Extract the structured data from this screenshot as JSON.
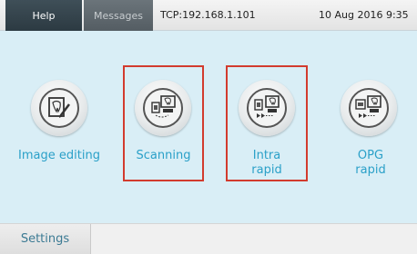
{
  "topbar": {
    "help_label": "Help",
    "messages_label": "Messages",
    "connection": "TCP:192.168.1.101",
    "datetime": "10 Aug 2016 9:35"
  },
  "modes": [
    {
      "label": "Image editing",
      "icon": "image-editing-icon",
      "highlighted": false
    },
    {
      "label": "Scanning",
      "icon": "scanning-icon",
      "highlighted": true
    },
    {
      "label": "Intra\nrapid",
      "icon": "intra-rapid-icon",
      "highlighted": true
    },
    {
      "label": "OPG\nrapid",
      "icon": "opg-rapid-icon",
      "highlighted": false
    }
  ],
  "bottombar": {
    "settings_label": "Settings"
  },
  "colors": {
    "label": "#2aa0c8",
    "highlight": "#d23b2e",
    "background": "#d9eef6"
  }
}
